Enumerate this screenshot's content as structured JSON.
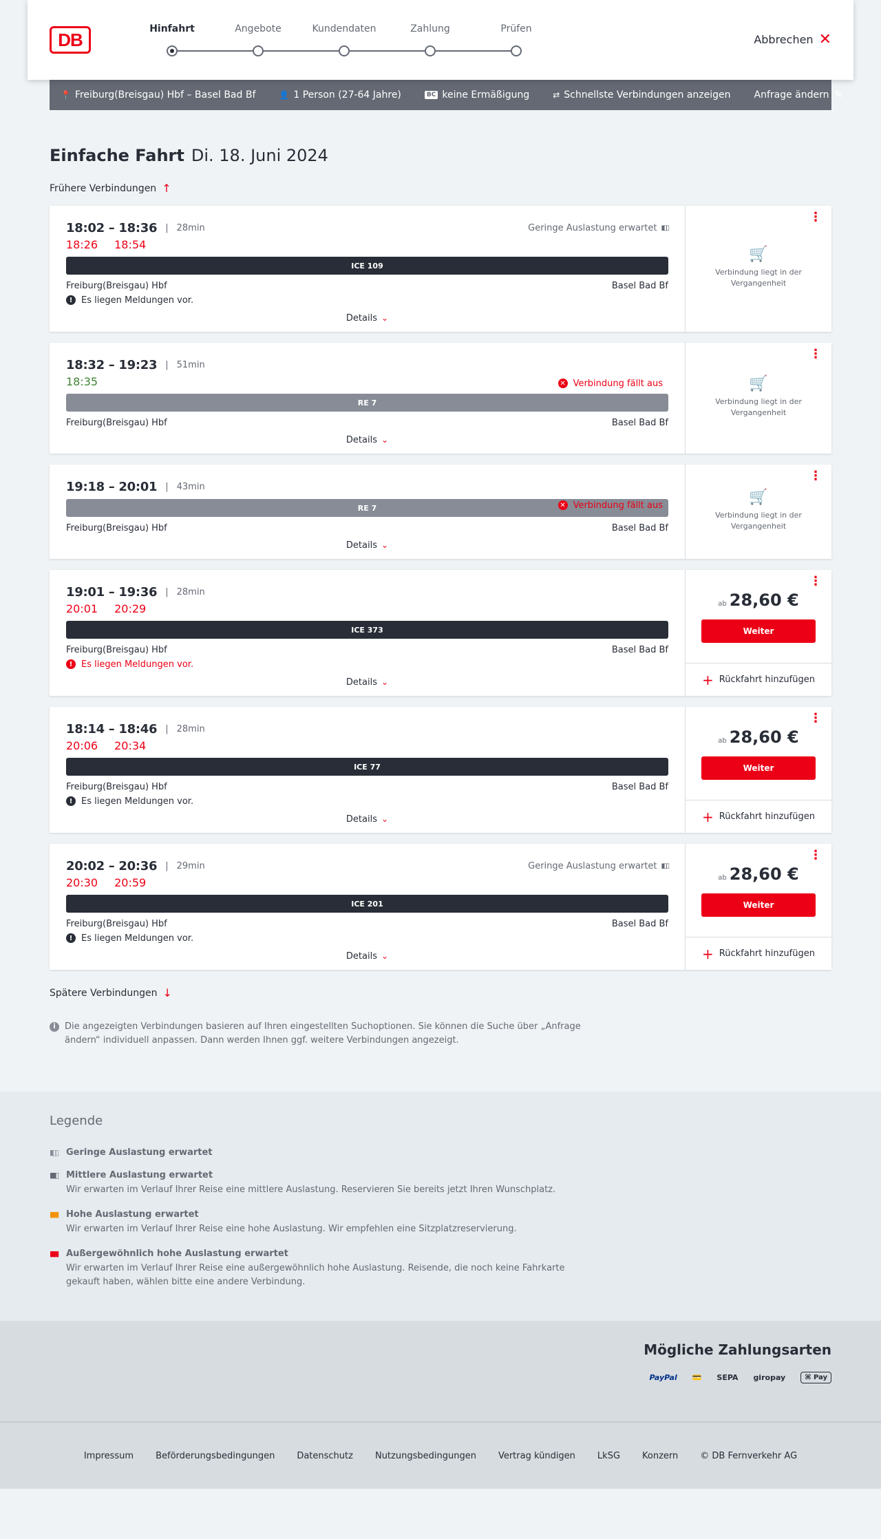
{
  "header": {
    "logo": "DB",
    "steps": [
      {
        "label": "Hinfahrt"
      },
      {
        "label": "Angebote"
      },
      {
        "label": "Kundendaten"
      },
      {
        "label": "Zahlung"
      },
      {
        "label": "Prüfen"
      }
    ],
    "active_step": "Hinfahrt",
    "cancel_label": "Abbrechen"
  },
  "filterbar": {
    "route": "Freiburg(Breisgau) Hbf – Basel Bad Bf",
    "persons": "1 Person (27-64 Jahre)",
    "bc_badge": "BC",
    "discount": "keine Ermäßigung",
    "fastest": "Schnellste Verbindungen anzeigen",
    "edit": "Anfrage ändern"
  },
  "main": {
    "trip_type": "Einfache Fahrt",
    "date": "Di. 18. Juni 2024",
    "earlier": "Frühere Verbindungen",
    "later": "Spätere Verbindungen",
    "details_label": "Details",
    "past_label": "Verbindung liegt in der Vergangenheit",
    "price_ab": "ab",
    "weiter_label": "Weiter",
    "return_label": "Rückfahrt hinzufügen",
    "info_note": "Die angezeigten Verbindungen basieren auf Ihren eingestellten Suchoptionen. Sie können die Suche über „Anfrage ändern“ individuell anpassen. Dann werden Ihnen ggf. weitere Verbindungen angezeigt."
  },
  "connections": [
    {
      "times": "18:02 – 18:36",
      "duration": "28min",
      "occupancy": "Geringe Auslastung erwartet",
      "rt_dep": "18:26",
      "rt_arr": "18:54",
      "train": "ICE 109",
      "from": "Freiburg(Breisgau) Hbf",
      "to": "Basel Bad Bf",
      "message": "Es liegen Meldungen vor."
    },
    {
      "times": "18:32 – 19:23",
      "duration": "51min",
      "rt_dep": "18:35",
      "train": "RE 7",
      "from": "Freiburg(Breisgau) Hbf",
      "to": "Basel Bad Bf",
      "message": "Verbindung fällt aus"
    },
    {
      "times": "19:18 – 20:01",
      "duration": "43min",
      "train": "RE 7",
      "from": "Freiburg(Breisgau) Hbf",
      "to": "Basel Bad Bf",
      "message": "Verbindung fällt aus"
    },
    {
      "times": "19:01 – 19:36",
      "duration": "28min",
      "rt_dep": "20:01",
      "rt_arr": "20:29",
      "train": "ICE 373",
      "from": "Freiburg(Breisgau) Hbf",
      "to": "Basel Bad Bf",
      "message": "Es liegen Meldungen vor.",
      "price": "28,60 €"
    },
    {
      "times": "18:14 – 18:46",
      "duration": "28min",
      "rt_dep": "20:06",
      "rt_arr": "20:34",
      "train": "ICE 77",
      "from": "Freiburg(Breisgau) Hbf",
      "to": "Basel Bad Bf",
      "message": "Es liegen Meldungen vor.",
      "price": "28,60 €"
    },
    {
      "times": "20:02 – 20:36",
      "duration": "29min",
      "occupancy": "Geringe Auslastung erwartet",
      "rt_dep": "20:30",
      "rt_arr": "20:59",
      "train": "ICE 201",
      "from": "Freiburg(Breisgau) Hbf",
      "to": "Basel Bad Bf",
      "message": "Es liegen Meldungen vor.",
      "price": "28,60 €"
    }
  ],
  "legend": {
    "title": "Legende",
    "items": [
      {
        "title": "Geringe Auslastung erwartet",
        "desc": ""
      },
      {
        "title": "Mittlere Auslastung erwartet",
        "desc": "Wir erwarten im Verlauf Ihrer Reise eine mittlere Auslastung. Reservieren Sie bereits jetzt Ihren Wunschplatz."
      },
      {
        "title": "Hohe Auslastung erwartet",
        "desc": "Wir erwarten im Verlauf Ihrer Reise eine hohe Auslastung. Wir empfehlen eine Sitzplatzreservierung."
      },
      {
        "title": "Außergewöhnlich hohe Auslastung erwartet",
        "desc": "Wir erwarten im Verlauf Ihrer Reise eine außergewöhnlich hohe Auslastung. Reisende, die noch keine Fahrkarte gekauft haben, wählen bitte eine andere Verbindung."
      }
    ]
  },
  "payments": {
    "title": "Mögliche Zahlungsarten",
    "paypal": "PayPal",
    "sepa": "SEPA",
    "giropay": "giropay",
    "applepay": "Pay"
  },
  "footer": {
    "links": [
      "Impressum",
      "Beförderungsbedingungen",
      "Datenschutz",
      "Nutzungsbedingungen",
      "Vertrag kündigen",
      "LkSG",
      "Konzern",
      "© DB Fernverkehr AG"
    ]
  },
  "colors": {
    "brand_red": "#ec0016",
    "dark": "#282d37",
    "gray": "#646973",
    "green": "#408335",
    "high": "#f39200"
  }
}
